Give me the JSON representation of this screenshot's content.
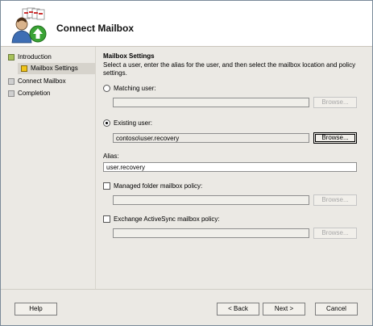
{
  "wizard": {
    "title": "Connect Mailbox"
  },
  "nav": {
    "items": [
      {
        "label": "Introduction"
      },
      {
        "label": "Mailbox Settings"
      },
      {
        "label": "Connect Mailbox"
      },
      {
        "label": "Completion"
      }
    ],
    "selected": "Mailbox Settings"
  },
  "section": {
    "title": "Mailbox Settings",
    "description": "Select a user, enter the alias for the user, and then select the mailbox location and policy settings."
  },
  "matching_user": {
    "label": "Matching user:",
    "value": "",
    "browse": "Browse...",
    "selected": false
  },
  "existing_user": {
    "label": "Existing user:",
    "value": "contoso\\user.recovery",
    "browse": "Browse...",
    "selected": true
  },
  "alias": {
    "label": "Alias:",
    "value": "user.recovery"
  },
  "managed_folder": {
    "label": "Managed folder mailbox policy:",
    "value": "",
    "browse": "Browse...",
    "checked": false
  },
  "activesync": {
    "label": "Exchange ActiveSync mailbox policy:",
    "value": "",
    "browse": "Browse...",
    "checked": false
  },
  "footer": {
    "help": "Help",
    "back": "< Back",
    "next": "Next >",
    "cancel": "Cancel"
  },
  "colors": {
    "nav_done": "#a7c15a",
    "nav_current": "#f0c419",
    "nav_pending": "#cfcfcf"
  }
}
